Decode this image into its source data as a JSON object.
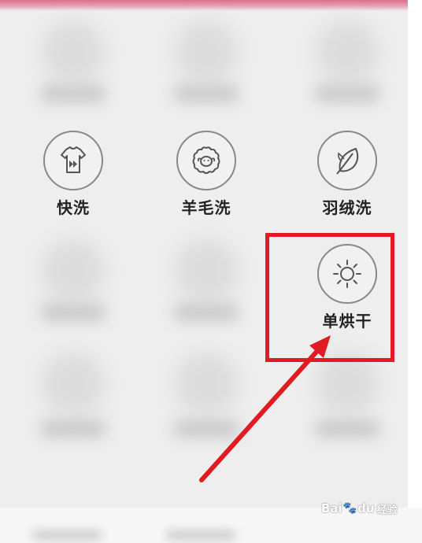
{
  "modes": [
    {
      "id": "quick",
      "label": "快洗",
      "icon": "tshirt-fast-icon"
    },
    {
      "id": "wool",
      "label": "羊毛洗",
      "icon": "sheep-icon"
    },
    {
      "id": "down",
      "label": "羽绒洗",
      "icon": "feather-icon"
    },
    {
      "id": "dry",
      "label": "单烘干",
      "icon": "sun-icon"
    }
  ],
  "highlight_color": "#e11b22",
  "watermark": {
    "brand_a": "Bai",
    "brand_b": "du",
    "suffix": "经验"
  }
}
